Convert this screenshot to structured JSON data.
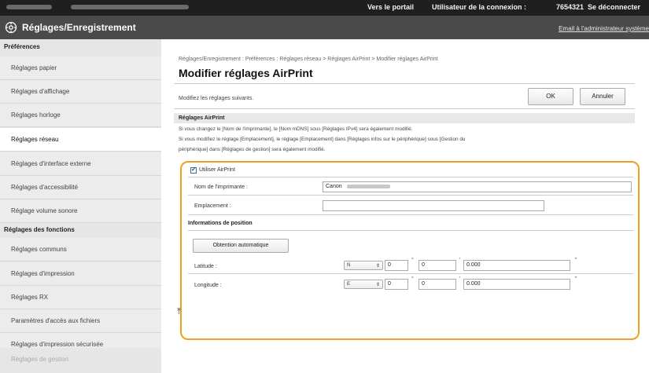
{
  "topbar": {
    "portal_link": "Vers le portail",
    "user_label": "Utilisateur de la connexion :",
    "user_id": "7654321",
    "logout": "Se déconnecter"
  },
  "titlebar": {
    "app_title": "Réglages/Enregistrement",
    "mail_link": "Email à l'administrateur système"
  },
  "sidebar": {
    "cat_preferences": "Préférences",
    "preferences": [
      "Réglages papier",
      "Réglages d'affichage",
      "Réglages horloge",
      "Réglages réseau",
      "Réglages d'interface externe",
      "Réglages d'accessibilité",
      "Réglage volume sonore"
    ],
    "cat_functions": "Réglages des fonctions",
    "functions": [
      "Réglages communs",
      "Réglages d'impression",
      "Réglages RX",
      "Paramètres d'accès aux fichiers",
      "Réglages d'impression sécurisée"
    ],
    "cat_management": "Réglages de gestion"
  },
  "main": {
    "breadcrumb": "Réglages/Enregistrement : Préférences : Réglages réseau > Réglages AirPrint > Modifier réglages AirPrint",
    "title": "Modifier réglages AirPrint",
    "instruction": "Modifiez les réglages suivants.",
    "ok": "OK",
    "cancel": "Annuler",
    "section_title": "Réglages AirPrint",
    "note1": "Si vous changez le [Nom de l'imprimante], le [Nom mDNS] sous [Réglages IPv4] sera également modifié.",
    "note2": "Si vous modifiez le réglage [Emplacement], le réglage [Emplacement] dans [Réglages infos sur le périphérique] sous [Gestion du",
    "note3": "périphérique] dans [Réglages de gestion] sera également modifié.",
    "use_airprint": "Utiliser AirPrint",
    "printer_name_label": "Nom de l'imprimante :",
    "printer_name_value": "Canon",
    "location_label": "Emplacement :",
    "location_value": "",
    "position_info": "Informations de position",
    "auto_button": "Obtention automatique",
    "latitude_label": "Latitude :",
    "latitude": {
      "hemisphere": "N",
      "degrees": "0",
      "minutes": "0",
      "seconds": "0.000"
    },
    "longitude_label": "Longitude :",
    "longitude": {
      "hemisphere": "E",
      "degrees": "0",
      "minutes": "0",
      "seconds": "0.000"
    },
    "deg_symbol": "°",
    "min_symbol": "'",
    "sec_symbol": "\"",
    "top_icon": "⤒"
  },
  "colors": {
    "highlight_border": "#f0a020",
    "titlebar": "#4a4a4a",
    "topbar": "#1f1f1f",
    "sidebar": "#e6e6e6"
  }
}
